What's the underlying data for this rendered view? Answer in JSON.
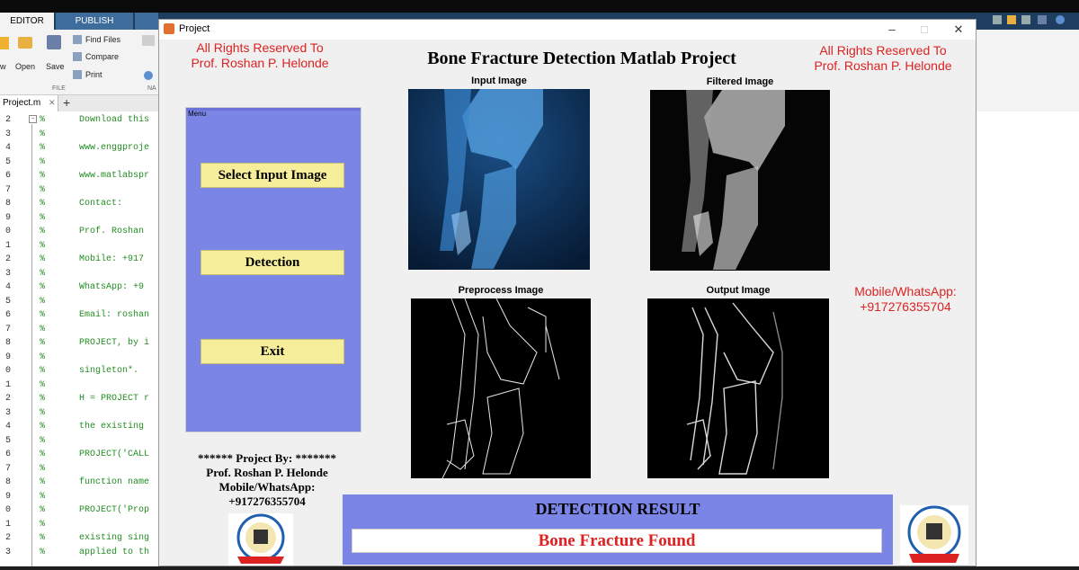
{
  "matlab": {
    "tabs": [
      "EDITOR",
      "PUBLISH"
    ],
    "toolbar": {
      "open": "Open",
      "save": "Save",
      "find_files": "Find Files",
      "compare": "Compare",
      "print": "Print",
      "section": "FILE",
      "partial_w": "w",
      "partial_na": "NA"
    },
    "file_tab": "Project.m",
    "line_numbers": [
      "2",
      "3",
      "4",
      "5",
      "6",
      "7",
      "8",
      "9",
      "0",
      "1",
      "2",
      "3",
      "4",
      "5",
      "6",
      "7",
      "8",
      "9",
      "0",
      "1",
      "2",
      "3",
      "4",
      "5",
      "6",
      "7",
      "8",
      "9",
      "0",
      "1",
      "2",
      "3"
    ],
    "code_lines": [
      {
        "row": 0,
        "text": "Download this"
      },
      {
        "row": 2,
        "text": "www.enggproje"
      },
      {
        "row": 4,
        "text": "www.matlabspr"
      },
      {
        "row": 6,
        "text": "Contact:"
      },
      {
        "row": 8,
        "text": "Prof. Roshan"
      },
      {
        "row": 10,
        "text": "Mobile: +917"
      },
      {
        "row": 12,
        "text": "WhatsApp: +9"
      },
      {
        "row": 14,
        "text": "Email: roshan"
      },
      {
        "row": 16,
        "text": "PROJECT, by i"
      },
      {
        "row": 18,
        "text": "singleton*."
      },
      {
        "row": 20,
        "text": "H = PROJECT r"
      },
      {
        "row": 22,
        "text": "the existing"
      },
      {
        "row": 24,
        "text": "PROJECT('CALL"
      },
      {
        "row": 26,
        "text": "function name"
      },
      {
        "row": 28,
        "text": "PROJECT('Prop"
      },
      {
        "row": 30,
        "text": "existing sing"
      },
      {
        "row": 31,
        "text": "applied to th"
      }
    ]
  },
  "window": {
    "title": "Project",
    "controls": {
      "minimize": "–",
      "maximize": "□",
      "close": "✕"
    }
  },
  "app": {
    "rights_left": [
      "All Rights Reserved To",
      "Prof. Roshan P. Helonde"
    ],
    "rights_right": [
      "All Rights Reserved To",
      "Prof. Roshan P. Helonde"
    ],
    "title": "Bone Fracture Detection Matlab Project",
    "images": {
      "input": "Input Image",
      "filtered": "Filtered Image",
      "preprocess": "Preprocess Image",
      "output": "Output Image"
    },
    "menu": {
      "label": "Menu",
      "select": "Select Input Image",
      "detect": "Detection",
      "exit": "Exit"
    },
    "contact_right": [
      "Mobile/WhatsApp:",
      "+917276355704"
    ],
    "credits": [
      "****** Project By: *******",
      "Prof. Roshan P. Helonde",
      "Mobile/WhatsApp:",
      "+917276355704"
    ],
    "result": {
      "title": "DETECTION RESULT",
      "value": "Bone Fracture Found"
    }
  },
  "colors": {
    "panel": "#7b85e6",
    "button": "#f6ee9a",
    "red_text": "#d22222",
    "code_comment": "#228b22"
  }
}
